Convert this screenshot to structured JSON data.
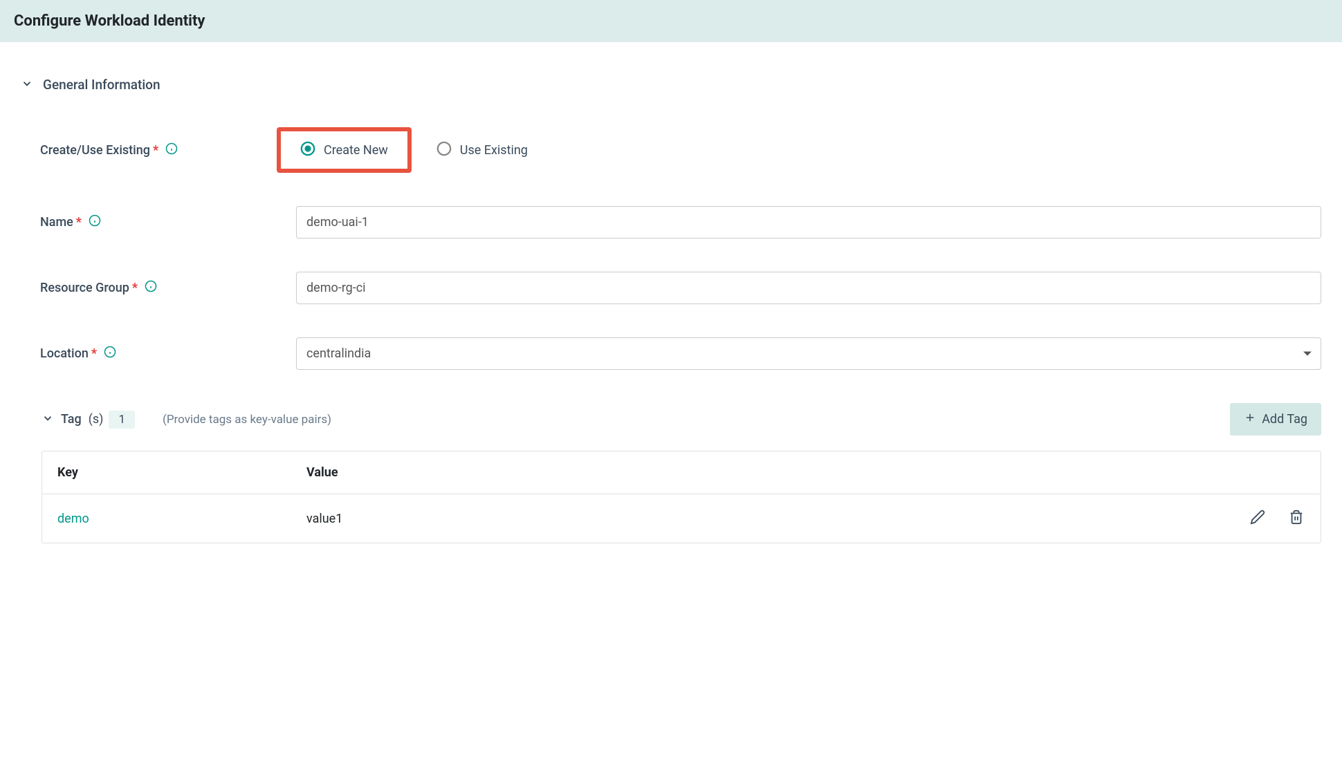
{
  "header": {
    "title": "Configure Workload Identity"
  },
  "section": {
    "title": "General Information"
  },
  "form": {
    "createUseExisting": {
      "label": "Create/Use Existing",
      "options": {
        "createNew": "Create New",
        "useExisting": "Use Existing"
      }
    },
    "name": {
      "label": "Name",
      "value": "demo-uai-1"
    },
    "resourceGroup": {
      "label": "Resource Group",
      "value": "demo-rg-ci"
    },
    "location": {
      "label": "Location",
      "value": "centralindia"
    }
  },
  "tags": {
    "title": "Tag",
    "suffix": "(s)",
    "count": "1",
    "hint": "(Provide tags as key-value pairs)",
    "addButton": "Add Tag",
    "columns": {
      "key": "Key",
      "value": "Value"
    },
    "rows": [
      {
        "key": "demo",
        "value": "value1"
      }
    ]
  }
}
